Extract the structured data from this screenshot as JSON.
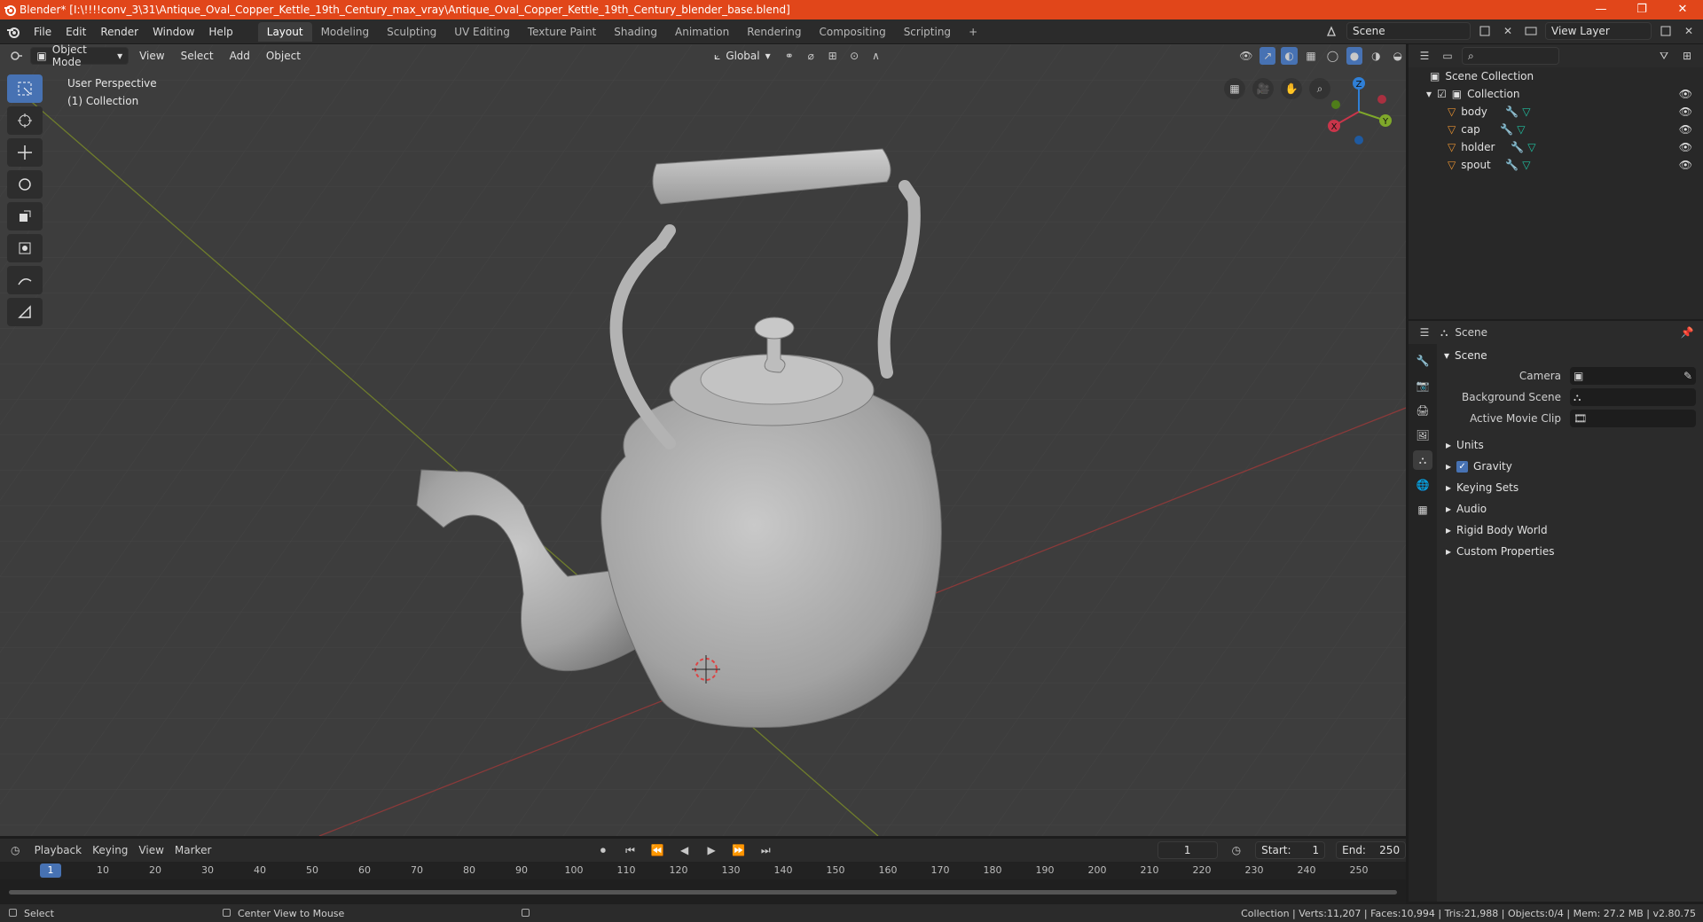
{
  "window": {
    "title": "Blender* [I:\\!!!!conv_3\\31\\Antique_Oval_Copper_Kettle_19th_Century_max_vray\\Antique_Oval_Copper_Kettle_19th_Century_blender_base.blend]",
    "minimize": "—",
    "maximize": "❐",
    "close": "✕"
  },
  "menu": {
    "items": [
      "File",
      "Edit",
      "Render",
      "Window",
      "Help"
    ],
    "workspaces": [
      "Layout",
      "Modeling",
      "Sculpting",
      "UV Editing",
      "Texture Paint",
      "Shading",
      "Animation",
      "Rendering",
      "Compositing",
      "Scripting"
    ],
    "active_workspace": "Layout",
    "add_tab": "+",
    "scene": "Scene",
    "view_layer": "View Layer"
  },
  "viewport": {
    "mode": "Object Mode",
    "menus": [
      "View",
      "Select",
      "Add",
      "Object"
    ],
    "orientation": "Global",
    "perspective_label": "User Perspective",
    "collection_label": "(1) Collection",
    "gizmo_axes": {
      "x": "X",
      "y": "Y",
      "z": "Z"
    }
  },
  "outliner": {
    "root": "Scene Collection",
    "collection": "Collection",
    "objects": [
      "body",
      "cap",
      "holder",
      "spout"
    ]
  },
  "properties": {
    "context": "Scene",
    "panel": "Scene",
    "fields": [
      {
        "label": "Camera"
      },
      {
        "label": "Background Scene"
      },
      {
        "label": "Active Movie Clip"
      }
    ],
    "subpanels": [
      "Units",
      "Gravity",
      "Keying Sets",
      "Audio",
      "Rigid Body World",
      "Custom Properties"
    ],
    "gravity_checked": true
  },
  "timeline": {
    "menus": [
      "Playback",
      "Keying",
      "View",
      "Marker"
    ],
    "current_frame": "1",
    "start_label": "Start:",
    "start": "1",
    "end_label": "End:",
    "end": "250",
    "ruler": [
      "1",
      "10",
      "20",
      "30",
      "40",
      "50",
      "60",
      "70",
      "80",
      "90",
      "100",
      "110",
      "120",
      "130",
      "140",
      "150",
      "160",
      "170",
      "180",
      "190",
      "200",
      "210",
      "220",
      "230",
      "240",
      "250"
    ]
  },
  "status": {
    "left_action": "Select",
    "mid_action": "Center View to Mouse",
    "stats": "Collection | Verts:11,207 | Faces:10,994 | Tris:21,988 | Objects:0/4 | Mem: 27.2 MB | v2.80.75"
  },
  "colors": {
    "accent": "#4772b3",
    "title_bar": "#e1461a",
    "axis_x": "#c9354a",
    "axis_y": "#7fa82a",
    "axis_z": "#2f7fd6",
    "object_icon": "#e69132",
    "mesh_icon": "#20c0a0"
  }
}
